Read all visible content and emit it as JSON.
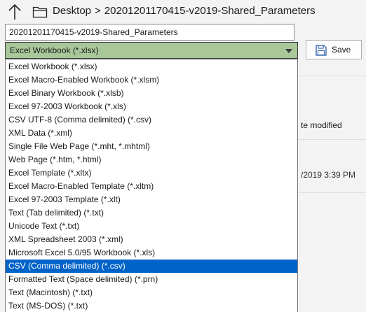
{
  "breadcrumb": {
    "location": "Desktop",
    "separator": ">",
    "folder": "20201201170415-v2019-Shared_Parameters"
  },
  "filename": {
    "value": "20201201170415-v2019-Shared_Parameters"
  },
  "save_as_type": {
    "selected": "Excel Workbook (*.xlsx)",
    "options": [
      "Excel Workbook (*.xlsx)",
      "Excel Macro-Enabled Workbook (*.xlsm)",
      "Excel Binary Workbook (*.xlsb)",
      "Excel 97-2003 Workbook (*.xls)",
      "CSV UTF-8 (Comma delimited) (*.csv)",
      "XML Data (*.xml)",
      "Single File Web Page (*.mht, *.mhtml)",
      "Web Page (*.htm, *.html)",
      "Excel Template (*.xltx)",
      "Excel Macro-Enabled Template (*.xltm)",
      "Excel 97-2003 Template (*.xlt)",
      "Text (Tab delimited) (*.txt)",
      "Unicode Text (*.txt)",
      "XML Spreadsheet 2003 (*.xml)",
      "Microsoft Excel 5.0/95 Workbook (*.xls)",
      "CSV (Comma delimited) (*.csv)",
      "Formatted Text (Space delimited) (*.prn)",
      "Text (Macintosh) (*.txt)",
      "Text (MS-DOS) (*.txt)"
    ],
    "highlighted_index": 15
  },
  "toolbar": {
    "save_label": "Save"
  },
  "file_list": {
    "column_header_partial": "te modified",
    "row_date_partial": "/2019 3:39 PM"
  },
  "colors": {
    "select_background": "#a8c89a",
    "highlight": "#0063c8"
  }
}
